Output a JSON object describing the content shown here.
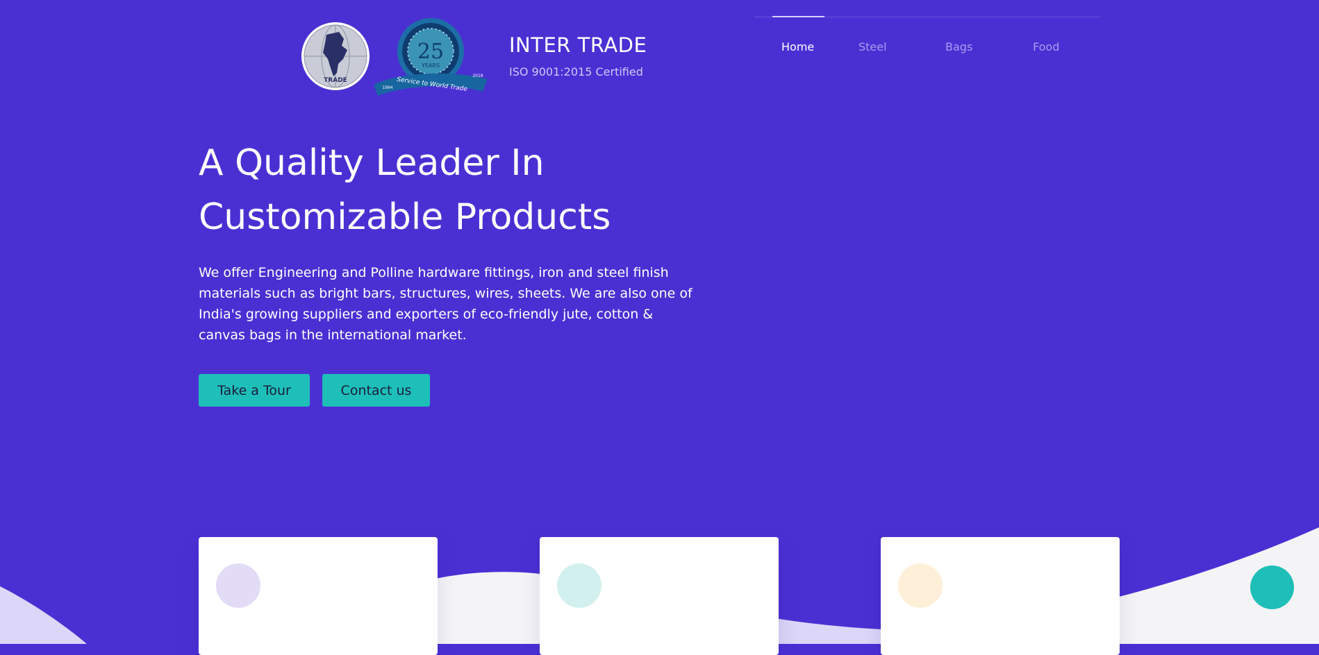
{
  "header": {
    "brand_name": "INTER TRADE",
    "certification": "ISO 9001:2015 Certified",
    "logo_globe_text": "TRADE",
    "anniversary_badge": {
      "number": "25",
      "word": "YEARS",
      "ribbon": "Service to World Trade",
      "start_year": "1994",
      "end_year": "2019"
    }
  },
  "nav": {
    "items": [
      {
        "label": "Home",
        "active": true
      },
      {
        "label": "Steel",
        "active": false
      },
      {
        "label": "Bags",
        "active": false
      },
      {
        "label": "Food",
        "active": false
      }
    ]
  },
  "hero": {
    "title_line1": "A Quality Leader In",
    "title_line2": "Customizable Products",
    "description": "We offer Engineering and Polline hardware fittings, iron and steel finish materials such as bright bars, structures, wires, sheets. We are also one of India's growing suppliers and exporters of eco-friendly jute, cotton & canvas bags in the international market.",
    "primary_button": "Take a Tour",
    "secondary_button": "Contact us"
  },
  "features": {
    "cards": [
      {
        "icon_color": "#e2dcf7"
      },
      {
        "icon_color": "#d2f1ee"
      },
      {
        "icon_color": "#fdefd8"
      }
    ]
  },
  "colors": {
    "background": "#4a30d3",
    "accent": "#1fbfb9",
    "wave_light": "#f4f4f6",
    "wave_lavender": "#dcd6f8",
    "nav_inactive": "#a79df0"
  }
}
